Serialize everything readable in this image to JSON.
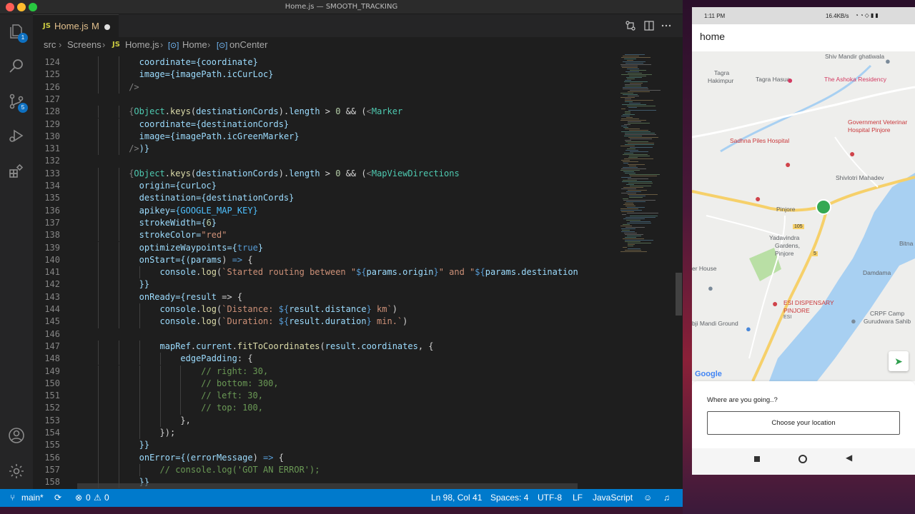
{
  "window": {
    "title": "Home.js — SMOOTH_TRACKING"
  },
  "activity_bar": {
    "explorer_badge": "1",
    "scm_badge": "5"
  },
  "tab": {
    "lang": "JS",
    "name": "Home.js",
    "modified": "M"
  },
  "breadcrumb": {
    "src": "src",
    "screens": "Screens",
    "file_lang": "JS",
    "file": "Home.js",
    "component": "Home",
    "method": "onCenter",
    "sym": "[⊙]"
  },
  "code_lines": [
    {
      "n": "124",
      "indent": 12,
      "tokens": [
        [
          "coordinate=",
          "attr"
        ],
        [
          "{coordinate}",
          "var"
        ]
      ]
    },
    {
      "n": "125",
      "indent": 12,
      "tokens": [
        [
          "image=",
          "attr"
        ],
        [
          "{imagePath.",
          "var"
        ],
        [
          "icCurLoc",
          "prop"
        ],
        [
          "}",
          "var"
        ]
      ]
    },
    {
      "n": "126",
      "indent": 10,
      "tokens": [
        [
          "/>",
          "punc"
        ]
      ]
    },
    {
      "n": "127",
      "indent": 0,
      "tokens": []
    },
    {
      "n": "128",
      "indent": 10,
      "tokens": [
        [
          "{",
          "punc"
        ],
        [
          "Object",
          "cls"
        ],
        [
          ".",
          "plain"
        ],
        [
          "keys",
          "fn"
        ],
        [
          "(",
          "plain"
        ],
        [
          "destinationCords",
          "var"
        ],
        [
          ").",
          "plain"
        ],
        [
          "length",
          "prop"
        ],
        [
          " > ",
          "plain"
        ],
        [
          "0",
          "num"
        ],
        [
          " && (",
          "plain"
        ],
        [
          "<",
          "punc"
        ],
        [
          "Marker",
          "tag"
        ]
      ]
    },
    {
      "n": "129",
      "indent": 12,
      "tokens": [
        [
          "coordinate=",
          "attr"
        ],
        [
          "{destinationCords}",
          "var"
        ]
      ]
    },
    {
      "n": "130",
      "indent": 12,
      "tokens": [
        [
          "image=",
          "attr"
        ],
        [
          "{imagePath.",
          "var"
        ],
        [
          "icGreenMarker",
          "prop"
        ],
        [
          "}",
          "var"
        ]
      ]
    },
    {
      "n": "131",
      "indent": 10,
      "tokens": [
        [
          "/>",
          "punc"
        ],
        [
          ")}",
          "var"
        ]
      ]
    },
    {
      "n": "132",
      "indent": 0,
      "tokens": []
    },
    {
      "n": "133",
      "indent": 10,
      "tokens": [
        [
          "{",
          "punc"
        ],
        [
          "Object",
          "cls"
        ],
        [
          ".",
          "plain"
        ],
        [
          "keys",
          "fn"
        ],
        [
          "(",
          "plain"
        ],
        [
          "destinationCords",
          "var"
        ],
        [
          ").",
          "plain"
        ],
        [
          "length",
          "prop"
        ],
        [
          " > ",
          "plain"
        ],
        [
          "0",
          "num"
        ],
        [
          " && (",
          "plain"
        ],
        [
          "<",
          "punc"
        ],
        [
          "MapViewDirections",
          "tag"
        ]
      ]
    },
    {
      "n": "134",
      "indent": 12,
      "tokens": [
        [
          "origin=",
          "attr"
        ],
        [
          "{curLoc}",
          "var"
        ]
      ]
    },
    {
      "n": "135",
      "indent": 12,
      "tokens": [
        [
          "destination=",
          "attr"
        ],
        [
          "{destinationCords}",
          "var"
        ]
      ]
    },
    {
      "n": "136",
      "indent": 12,
      "tokens": [
        [
          "apikey=",
          "attr"
        ],
        [
          "{GOOGLE_MAP_KEY}",
          "const"
        ]
      ]
    },
    {
      "n": "137",
      "indent": 12,
      "tokens": [
        [
          "strokeWidth=",
          "attr"
        ],
        [
          "{",
          "var"
        ],
        [
          "6",
          "num"
        ],
        [
          "}",
          "var"
        ]
      ]
    },
    {
      "n": "138",
      "indent": 12,
      "tokens": [
        [
          "strokeColor=",
          "attr"
        ],
        [
          "\"red\"",
          "str"
        ]
      ]
    },
    {
      "n": "139",
      "indent": 12,
      "tokens": [
        [
          "optimizeWaypoints=",
          "attr"
        ],
        [
          "{",
          "var"
        ],
        [
          "true",
          "kw"
        ],
        [
          "}",
          "var"
        ]
      ]
    },
    {
      "n": "140",
      "indent": 12,
      "tokens": [
        [
          "onStart=",
          "attr"
        ],
        [
          "{(",
          "var"
        ],
        [
          "params",
          "var"
        ],
        [
          ") ",
          "plain"
        ],
        [
          "=>",
          "kw"
        ],
        [
          " {",
          "plain"
        ]
      ]
    },
    {
      "n": "141",
      "indent": 16,
      "tokens": [
        [
          "console",
          "var"
        ],
        [
          ".",
          "plain"
        ],
        [
          "log",
          "fn"
        ],
        [
          "(",
          "plain"
        ],
        [
          "`Started routing between \"",
          "str"
        ],
        [
          "${",
          "kw"
        ],
        [
          "params.origin",
          "var"
        ],
        [
          "}",
          "kw"
        ],
        [
          "\" and \"",
          "str"
        ],
        [
          "${",
          "kw"
        ],
        [
          "params.destination",
          "var"
        ]
      ]
    },
    {
      "n": "142",
      "indent": 12,
      "tokens": [
        [
          "}}",
          "var"
        ]
      ]
    },
    {
      "n": "143",
      "indent": 12,
      "tokens": [
        [
          "onReady=",
          "attr"
        ],
        [
          "{",
          "var"
        ],
        [
          "result",
          "var"
        ],
        [
          " => {",
          "plain"
        ]
      ]
    },
    {
      "n": "144",
      "indent": 16,
      "tokens": [
        [
          "console",
          "var"
        ],
        [
          ".",
          "plain"
        ],
        [
          "log",
          "fn"
        ],
        [
          "(",
          "plain"
        ],
        [
          "`Distance: ",
          "str"
        ],
        [
          "${",
          "kw"
        ],
        [
          "result.distance",
          "var"
        ],
        [
          "}",
          "kw"
        ],
        [
          " km`",
          "str"
        ],
        [
          ")",
          "plain"
        ]
      ]
    },
    {
      "n": "145",
      "indent": 16,
      "tokens": [
        [
          "console",
          "var"
        ],
        [
          ".",
          "plain"
        ],
        [
          "log",
          "fn"
        ],
        [
          "(",
          "plain"
        ],
        [
          "`Duration: ",
          "str"
        ],
        [
          "${",
          "kw"
        ],
        [
          "result.duration",
          "var"
        ],
        [
          "}",
          "kw"
        ],
        [
          " min.`",
          "str"
        ],
        [
          ")",
          "plain"
        ]
      ]
    },
    {
      "n": "146",
      "indent": 0,
      "tokens": []
    },
    {
      "n": "147",
      "indent": 16,
      "tokens": [
        [
          "mapRef",
          "var"
        ],
        [
          ".",
          "plain"
        ],
        [
          "current",
          "var"
        ],
        [
          ".",
          "plain"
        ],
        [
          "fitToCoordinates",
          "fn"
        ],
        [
          "(",
          "plain"
        ],
        [
          "result",
          "var"
        ],
        [
          ".",
          "plain"
        ],
        [
          "coordinates",
          "var"
        ],
        [
          ", {",
          "plain"
        ]
      ]
    },
    {
      "n": "148",
      "indent": 20,
      "tokens": [
        [
          "edgePadding",
          "var"
        ],
        [
          ": {",
          "plain"
        ]
      ]
    },
    {
      "n": "149",
      "indent": 24,
      "tokens": [
        [
          "// right: 30,",
          "cmt"
        ]
      ]
    },
    {
      "n": "150",
      "indent": 24,
      "tokens": [
        [
          "// bottom: 300,",
          "cmt"
        ]
      ]
    },
    {
      "n": "151",
      "indent": 24,
      "tokens": [
        [
          "// left: 30,",
          "cmt"
        ]
      ]
    },
    {
      "n": "152",
      "indent": 24,
      "tokens": [
        [
          "// top: 100,",
          "cmt"
        ]
      ]
    },
    {
      "n": "153",
      "indent": 20,
      "tokens": [
        [
          "},",
          "plain"
        ]
      ]
    },
    {
      "n": "154",
      "indent": 16,
      "tokens": [
        [
          "});",
          "plain"
        ]
      ]
    },
    {
      "n": "155",
      "indent": 12,
      "tokens": [
        [
          "}}",
          "var"
        ]
      ]
    },
    {
      "n": "156",
      "indent": 12,
      "tokens": [
        [
          "onError=",
          "attr"
        ],
        [
          "{(",
          "var"
        ],
        [
          "errorMessage",
          "var"
        ],
        [
          ") ",
          "plain"
        ],
        [
          "=>",
          "kw"
        ],
        [
          " {",
          "plain"
        ]
      ]
    },
    {
      "n": "157",
      "indent": 16,
      "tokens": [
        [
          "// console.log('GOT AN ERROR');",
          "cmt"
        ]
      ]
    },
    {
      "n": "158",
      "indent": 12,
      "tokens": [
        [
          "}}",
          "var"
        ]
      ]
    }
  ],
  "colors": {
    "attr": "#9cdcfe",
    "var": "#9cdcfe",
    "prop": "#9cdcfe",
    "punc": "#808080",
    "tag": "#4ec9b0",
    "cls": "#4ec9b0",
    "fn": "#dcdcaa",
    "num": "#b5cea8",
    "str": "#ce9178",
    "kw": "#569cd6",
    "const": "#4fc1ff",
    "cmt": "#6a9955",
    "plain": "#d4d4d4"
  },
  "statusbar": {
    "branch": "main*",
    "errors": "0",
    "warnings": "0",
    "position": "Ln 98, Col 41",
    "spaces": "Spaces: 4",
    "encoding": "UTF-8",
    "eol": "LF",
    "language": "JavaScript"
  },
  "phone": {
    "status_time": "1:11 PM",
    "status_right": "16.4KB/s",
    "app_title": "home",
    "map_labels": [
      "Shiv Mandir ghatiwala",
      "Tagra",
      "Hakimpur",
      "Tagra Hasua",
      "The Ashoka Residency",
      "Government Veterinar",
      "Hospital Pinjore",
      "Sadhna Piles Hospital",
      "Shivlotri Mahadev",
      "Pinjore",
      "Yadavindra",
      "Gardens,",
      "Pinjore",
      "Bitna",
      "er House",
      "Damdama",
      "ESI DISPENSARY",
      "PINJORE",
      "ESI",
      "CRPF Camp",
      "Gurudwara Sahib",
      "bji Mandi Ground",
      "105",
      "5"
    ],
    "google": "Google",
    "question": "Where are you going..?",
    "choose_button": "Choose your location"
  }
}
